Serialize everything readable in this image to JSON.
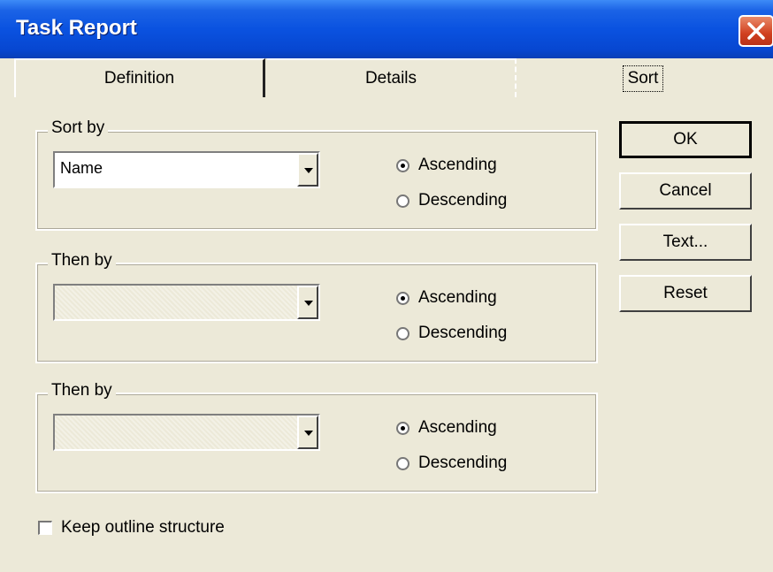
{
  "window": {
    "title": "Task Report"
  },
  "tabs": [
    {
      "label": "Definition"
    },
    {
      "label": "Details"
    },
    {
      "label": "Sort",
      "selected": true
    }
  ],
  "groups": [
    {
      "legend": "Sort by",
      "combo_value": "Name",
      "ascending": "Ascending",
      "descending": "Descending",
      "selected": "Ascending"
    },
    {
      "legend": "Then by",
      "combo_value": "",
      "ascending": "Ascending",
      "descending": "Descending",
      "selected": "Ascending"
    },
    {
      "legend": "Then by",
      "combo_value": "",
      "ascending": "Ascending",
      "descending": "Descending",
      "selected": "Ascending"
    }
  ],
  "buttons": {
    "ok": "OK",
    "cancel": "Cancel",
    "text": "Text...",
    "reset": "Reset"
  },
  "keep_outline": {
    "label": "Keep outline structure",
    "checked": false
  },
  "icons": [
    "close-icon",
    "dropdown-arrow-icon"
  ],
  "colors": {
    "titlebar": "#0a52e0",
    "face": "#ece9d8",
    "close": "#d1401f"
  }
}
